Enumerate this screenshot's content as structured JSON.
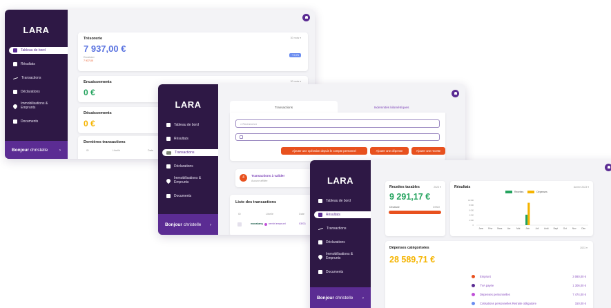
{
  "brand": {
    "logo": "LARA",
    "greeting_bold": "Bonjour",
    "greeting_name": "christelle",
    "greeting_arrow": "›"
  },
  "nav": {
    "dashboard": "Tableau de bord",
    "results": "Résultats",
    "transactions": "Transactions",
    "declarations": "Déclarations",
    "immobilisations": "Immobilisations &",
    "emprunts": "Emprunts",
    "documents": "Documents"
  },
  "screen1": {
    "tresorerie": {
      "title": "Trésorerie",
      "period": "30 mois ▾",
      "amount": "7 937,00 €",
      "sub_label": "Encaisser",
      "sub_value": "7 937,00",
      "badge": "+ 0,0%"
    },
    "encaissements": {
      "title": "Encaissements",
      "period": "30 mois ▾",
      "amount": "0 €"
    },
    "decaissements": {
      "title": "Décaissements",
      "amount": "0 €"
    },
    "dernieres": {
      "title": "Dernières transactions",
      "col_id": "ID",
      "col_libelle": "Libellé",
      "col_date": "Date"
    }
  },
  "screen2": {
    "tab_transactions": "Transactions",
    "tab_indemnites": "Indemnités kilométriques",
    "search_placeholder": "Rechercher",
    "btn_operation": "Ajouter une opération depuis le compte personnel",
    "btn_depense": "Ajouter une dépense",
    "btn_recette": "Ajouter une recette",
    "to_classify_count": "4",
    "to_classify_label": "Transactions à valider",
    "to_classify_sub": "Aucune affiliée",
    "list_title": "Liste des transactions",
    "col_id": "ID",
    "col_libelle": "Libellé",
    "col_date": "Date",
    "row_bank": "monabanq",
    "row_label": "rembt emprunt",
    "row_date": "03/02/2023"
  },
  "screen3": {
    "recettes": {
      "title": "Recettes taxables",
      "period": "2023 ▾",
      "amount": "9 291,17 €",
      "sub_label": "Décaissé",
      "sub_value": "Déficit"
    },
    "resultats": {
      "title": "Résultats",
      "period": "Année 2023 ▾",
      "legend_recettes": "Recettes",
      "legend_depenses": "Dépenses",
      "y_ticks": [
        "10 000",
        "8 000",
        "6 000",
        "4 000",
        "2 000",
        "0"
      ]
    },
    "depenses": {
      "title": "Dépenses catégorisées",
      "period": "2023 ▾",
      "amount": "28 589,71 €"
    }
  },
  "chart_data": {
    "type": "bar",
    "categories": [
      "Janv",
      "Févr",
      "Mars",
      "Avr",
      "Mai",
      "Juin",
      "Juil",
      "Août",
      "Sept",
      "Oct",
      "Nov",
      "Déc"
    ],
    "series": [
      {
        "name": "Recettes",
        "values": [
          0,
          0,
          0,
          0,
          0,
          4200,
          0,
          0,
          0,
          0,
          0,
          0
        ]
      },
      {
        "name": "Dépenses",
        "values": [
          0,
          0,
          0,
          0,
          0,
          9000,
          0,
          0,
          0,
          0,
          0,
          0
        ]
      }
    ],
    "title": "Résultats",
    "ylim": [
      0,
      10000
    ],
    "grid": false,
    "legend": "top"
  },
  "categories_list": [
    {
      "name": "Emprunt",
      "value": "3 080,00 €",
      "color": "#e8511e"
    },
    {
      "name": "TVA payée",
      "value": "1 306,00 €",
      "color": "#5b2c93"
    },
    {
      "name": "Dépenses personnelles",
      "value": "7 474,00 €",
      "color": "#c050d8"
    },
    {
      "name": "Cotisations personnelles Retraite obligatoire",
      "value": "150,00 €",
      "color": "#6b8df0"
    }
  ],
  "colors": {
    "sidebar": "#2e1845",
    "accent": "#5b2c93",
    "blue": "#5a73e0",
    "green": "#24a35e",
    "yellow": "#f5b400",
    "orange": "#e8511e"
  }
}
